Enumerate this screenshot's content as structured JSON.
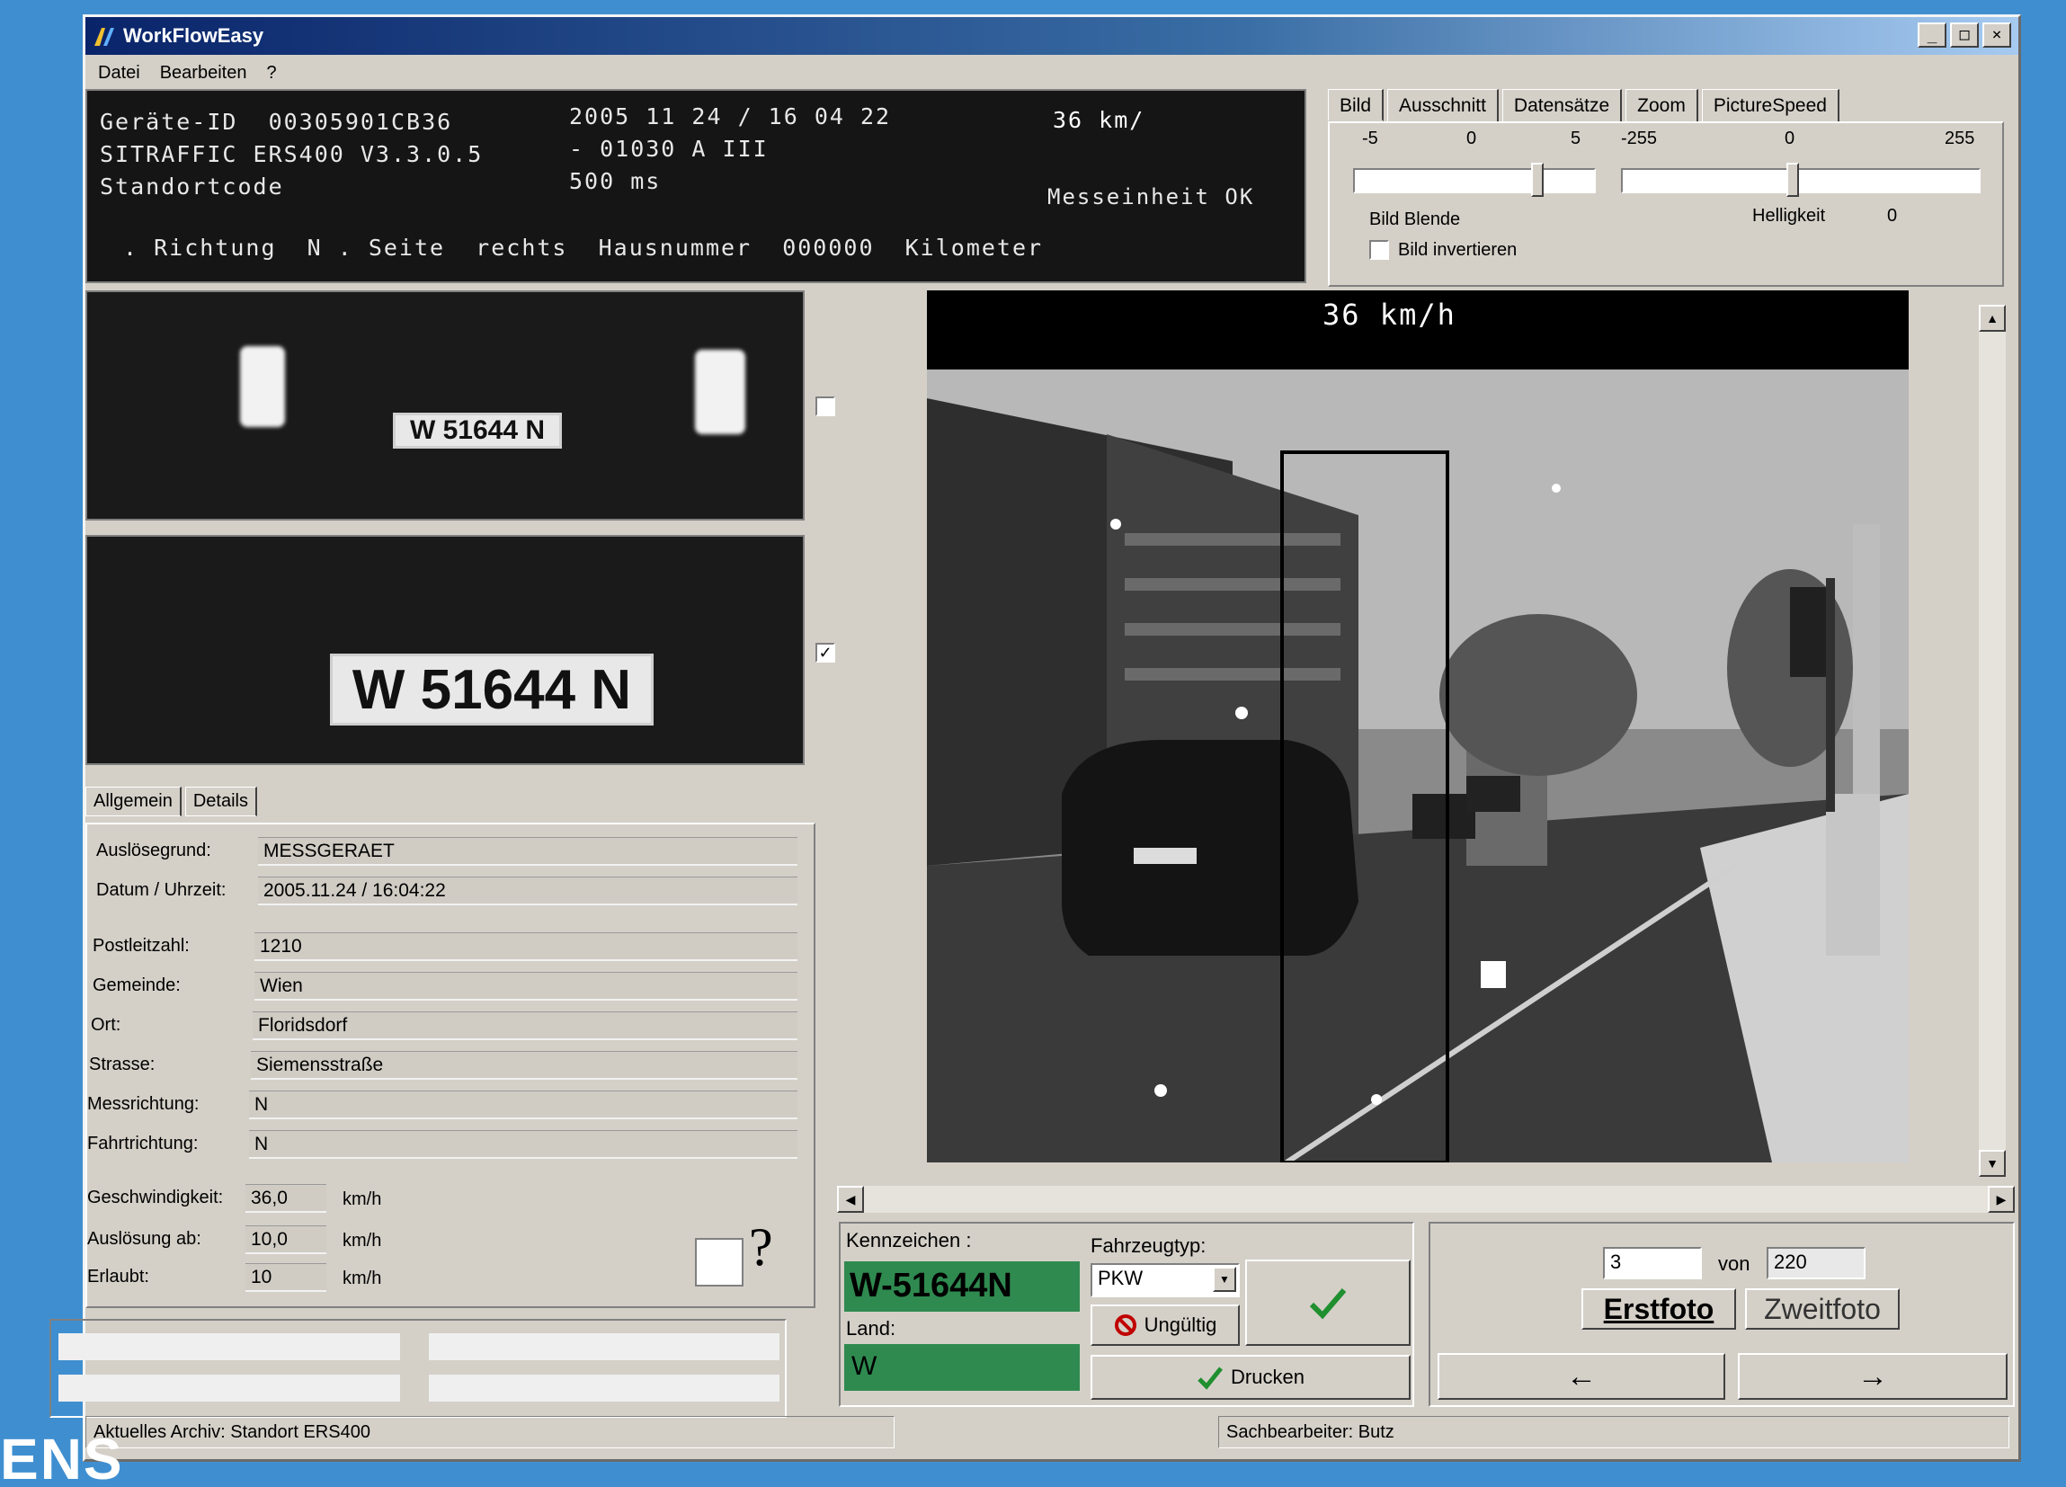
{
  "window": {
    "title": "WorkFlowEasy",
    "controls": [
      "_",
      "□",
      "×"
    ]
  },
  "menu": [
    "Datei",
    "Bearbeiten",
    "?"
  ],
  "header": {
    "geraete_id": "Geräte-ID  00305901CB36",
    "system": "SITRAFFIC ERS400 V3.3.0.5",
    "standort": "Standortcode",
    "datetime": "2005 11 24 / 16 04 22",
    "code": "- 01030 A III",
    "ms": "500 ms",
    "speed": "36 km/",
    "messeinheit": "Messeinheit OK",
    "bottom_line": ". Richtung  N . Seite  rechts  Hausnummer  000000  Kilometer"
  },
  "image_tabs": {
    "tabs": [
      "Bild",
      "Ausschnitt",
      "Datensätze",
      "Zoom",
      "PictureSpeed"
    ],
    "blende": {
      "min": "-5",
      "mid": "0",
      "max": "5",
      "label": "Bild Blende",
      "value": 3
    },
    "helligkeit": {
      "min": "-255",
      "mid": "0",
      "max": "255",
      "label": "Helligkeit",
      "value": "0"
    },
    "invert_label": "Bild invertieren"
  },
  "plates": {
    "plate_text_top": "W 51644 N",
    "plate_text_bottom": "W 51644 N"
  },
  "detail_tabs": [
    "Allgemein",
    "Details"
  ],
  "fields": [
    {
      "label": "Auslösegrund:",
      "value": "MESSGERAET"
    },
    {
      "label": "Datum / Uhrzeit:",
      "value": "2005.11.24 / 16:04:22"
    },
    {
      "label": "Postleitzahl:",
      "value": "1210"
    },
    {
      "label": "Gemeinde:",
      "value": "Wien"
    },
    {
      "label": "Ort:",
      "value": "Floridsdorf"
    },
    {
      "label": "Strasse:",
      "value": "Siemensstraße"
    },
    {
      "label": "Messrichtung:",
      "value": "N"
    },
    {
      "label": "Fahrtrichtung:",
      "value": "N"
    }
  ],
  "speeds": [
    {
      "label": "Geschwindigkeit:",
      "value": "36,0",
      "unit": "km/h"
    },
    {
      "label": "Auslösung ab:",
      "value": "10,0",
      "unit": "km/h"
    },
    {
      "label": "Erlaubt:",
      "value": "10",
      "unit": "km/h"
    }
  ],
  "help": "?",
  "photo": {
    "speed": "36 km/h"
  },
  "kennzeichen": {
    "label": "Kennzeichen :",
    "value": "W-51644N",
    "land_label": "Land:",
    "land_value": "W",
    "fahrzeugtyp_label": "Fahrzeugtyp:",
    "fahrzeugtyp_value": "PKW",
    "ungueltig": "Ungültig",
    "drucken": "Drucken"
  },
  "navigation": {
    "current": "3",
    "von": "von",
    "total": "220",
    "erstfoto": "Erstfoto",
    "zweitfoto": "Zweitfoto",
    "prev": "←",
    "next": "→"
  },
  "status": {
    "archiv": "Aktuelles Archiv: Standort ERS400",
    "user": "Sachbearbeiter: Butz"
  },
  "brand": "ENS",
  "colors": {
    "accent_green": "#2f8a50",
    "title_bar": "#0a246a"
  }
}
